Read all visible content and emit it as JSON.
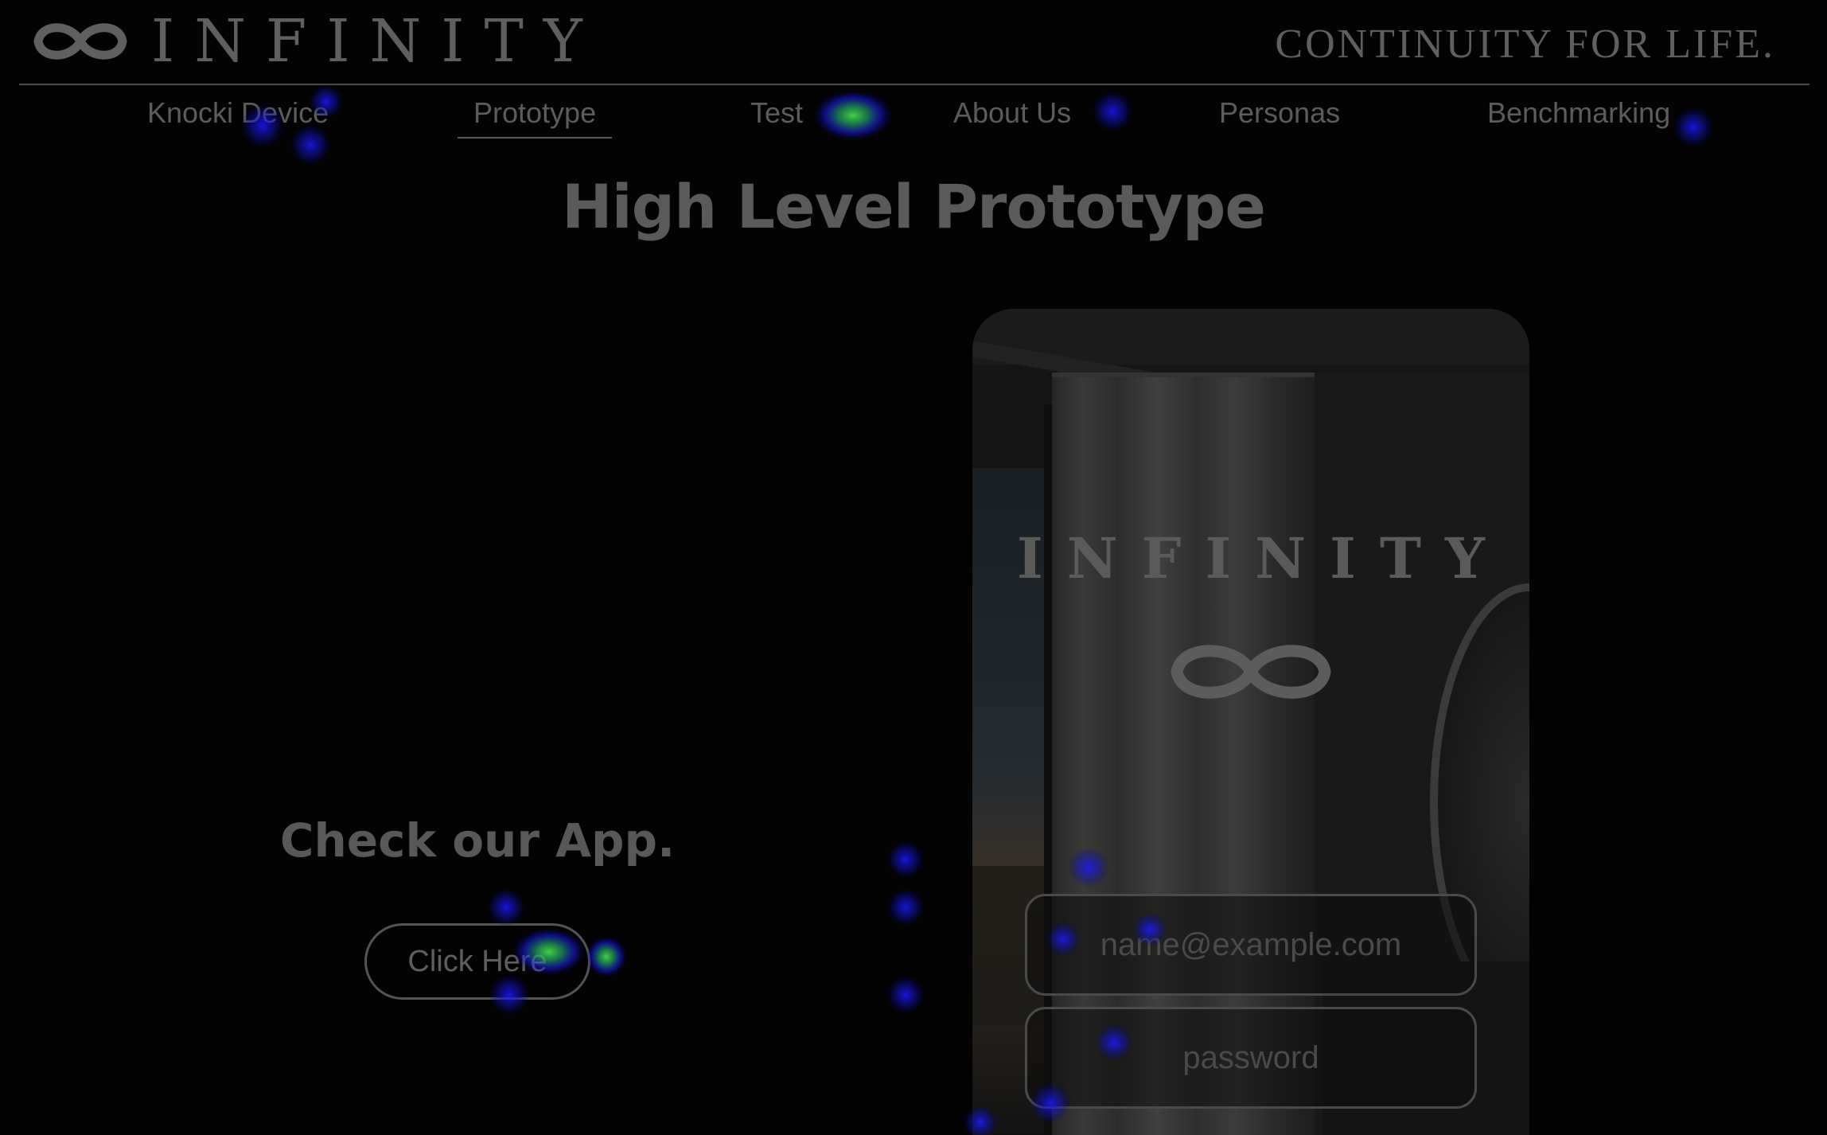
{
  "header": {
    "logo_text": "INFINITY",
    "tagline": "CONTINUITY FOR LIFE."
  },
  "nav": {
    "items": [
      "Knocki Device",
      "Prototype",
      "Test",
      "About Us",
      "Personas",
      "Benchmarking"
    ],
    "active": "Prototype"
  },
  "main": {
    "title": "High Level Prototype",
    "cta_heading": "Check our App.",
    "cta_button": "Click Here"
  },
  "phone": {
    "app_title": "INFINITY",
    "email_placeholder": "name@example.com",
    "password_placeholder": "password"
  },
  "icons": {
    "logo": "infinity-icon",
    "app_logo": "infinity-icon"
  },
  "colors": {
    "background": "#030303",
    "text": "#5e5e5e",
    "heat_low": "#1a1aff",
    "heat_high": "#33cc33"
  }
}
